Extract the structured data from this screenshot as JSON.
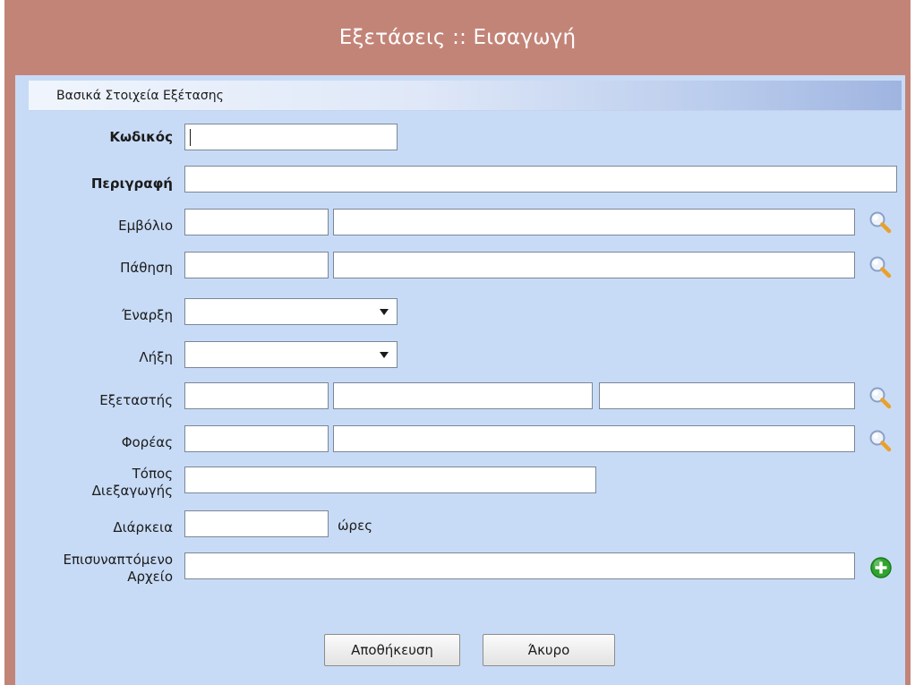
{
  "window": {
    "title": "Εξετάσεις :: Εισαγωγή"
  },
  "section": {
    "title": "Βασικά Στοιχεία Εξέτασης"
  },
  "fields": {
    "code": {
      "label": "Κωδικός",
      "value": ""
    },
    "description": {
      "label": "Περιγραφή",
      "value": ""
    },
    "vaccine": {
      "label": "Εμβόλιο",
      "code": "",
      "name": ""
    },
    "disease": {
      "label": "Πάθηση",
      "code": "",
      "name": ""
    },
    "start": {
      "label": "Έναρξη",
      "value": ""
    },
    "end": {
      "label": "Λήξη",
      "value": ""
    },
    "examiner": {
      "label": "Εξεταστής",
      "code": "",
      "surname": "",
      "name": ""
    },
    "organization": {
      "label": "Φορέας",
      "code": "",
      "name": ""
    },
    "location": {
      "label_line1": "Τόπος",
      "label_line2": "Διεξαγωγής",
      "value": ""
    },
    "duration": {
      "label": "Διάρκεια",
      "value": "",
      "unit": "ώρες"
    },
    "attachment": {
      "label_line1": "Επισυναπτόμενο",
      "label_line2": "Αρχείο",
      "value": ""
    }
  },
  "buttons": {
    "save": "Αποθήκευση",
    "cancel": "Άκυρο"
  },
  "icons": {
    "lookup": "magnifier-icon",
    "add": "add-icon"
  },
  "colors": {
    "titlebar": "#c38478",
    "panel": "#c8dbf6",
    "add_icon": "#2fa52f"
  }
}
